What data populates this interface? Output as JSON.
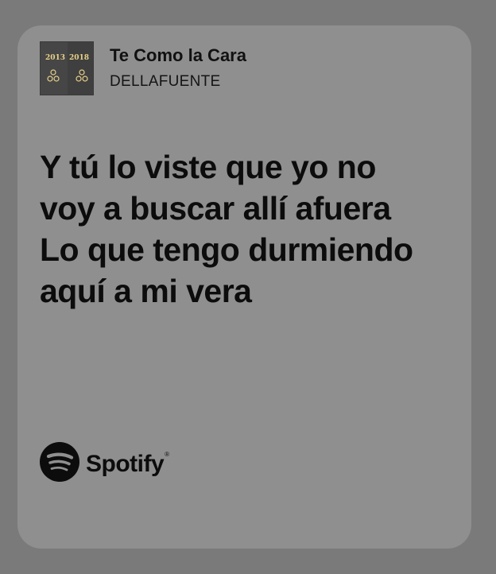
{
  "track": {
    "title": "Te Como la Cara",
    "artist": "DELLAFUENTE",
    "cover_icon": "album-cover-image"
  },
  "lyrics": {
    "lines": [
      "Y tú lo viste que yo no voy a buscar allí afuera",
      "Lo que tengo durmiendo aquí a mi vera"
    ]
  },
  "brand": {
    "name": "Spotify",
    "icon": "spotify-logo-icon"
  },
  "colors": {
    "background": "#7a7a7a",
    "card": "#8f8f8f",
    "text": "#0c0c0c"
  }
}
